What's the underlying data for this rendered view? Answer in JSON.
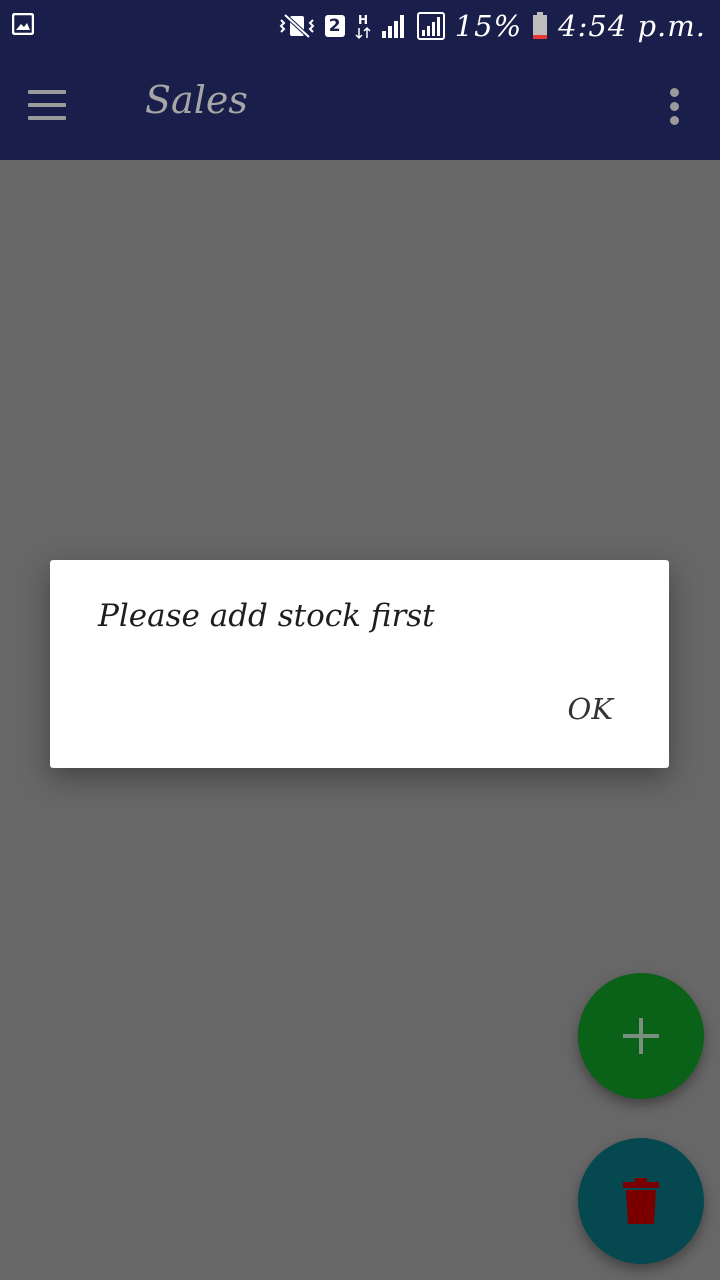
{
  "status_bar": {
    "sim_slot": "2",
    "network_type": "H",
    "battery_percent": "15%",
    "time": "4:54 p.m.",
    "icons": [
      "gallery-notification-icon",
      "vibrate-icon",
      "sim-2-icon",
      "data-hplus-icon",
      "signal-icon",
      "signal-sim2-icon",
      "battery-icon"
    ]
  },
  "app_bar": {
    "title": "Sales",
    "icons": [
      "menu-icon",
      "overflow-menu-icon"
    ]
  },
  "dialog": {
    "message": "Please add stock first",
    "ok_label": "OK"
  },
  "fabs": {
    "add_icon": "plus-icon",
    "delete_icon": "trash-icon"
  },
  "colors": {
    "app_bar": "#1a1e4a",
    "scrim": "#676767",
    "fab_add": "#0a6118",
    "fab_delete": "#05484f",
    "trash_icon": "#7a0000",
    "battery_low": "#e53935"
  }
}
